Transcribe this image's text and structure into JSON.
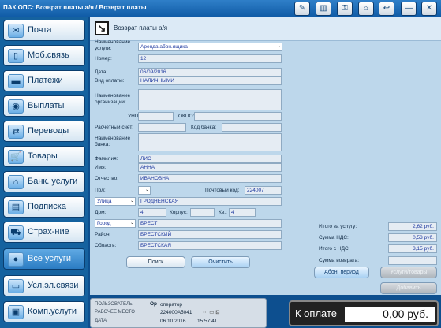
{
  "titlebar": {
    "title": "ПАК ОПС: Возврат платы а/я / Возврат платы",
    "buttons": [
      {
        "name": "wrench-pen-icon",
        "glyph": "✎"
      },
      {
        "name": "barcode-icon",
        "glyph": "▥"
      },
      {
        "name": "key-icon",
        "glyph": "⚿"
      },
      {
        "name": "home-icon",
        "glyph": "⌂"
      },
      {
        "name": "back-arrow-icon",
        "glyph": "↩"
      },
      {
        "name": "minimize-icon",
        "glyph": "—"
      },
      {
        "name": "close-icon",
        "glyph": "✕"
      }
    ]
  },
  "sidebar": {
    "items": [
      {
        "label": "Почта",
        "icon": "envelope-icon",
        "glyph": "✉",
        "active": false
      },
      {
        "label": "Моб.связь",
        "icon": "mobile-phone-icon",
        "glyph": "▯",
        "active": false
      },
      {
        "label": "Платежи",
        "icon": "payment-icon",
        "glyph": "▬",
        "active": false
      },
      {
        "label": "Выплаты",
        "icon": "cash-icon",
        "glyph": "◉",
        "active": false
      },
      {
        "label": "Переводы",
        "icon": "transfer-icon",
        "glyph": "⇄",
        "active": false
      },
      {
        "label": "Товары",
        "icon": "cart-icon",
        "glyph": "🛒",
        "active": false
      },
      {
        "label": "Банк. услуги",
        "icon": "bank-icon",
        "glyph": "⌂",
        "active": false
      },
      {
        "label": "Подписка",
        "icon": "subscription-icon",
        "glyph": "▤",
        "active": false
      },
      {
        "label": "Страх-ние",
        "icon": "car-icon",
        "glyph": "⛟",
        "active": false
      },
      {
        "label": "Все услуги",
        "icon": "all-services-icon",
        "glyph": "●",
        "active": true
      },
      {
        "label": "Усл.эл.связи",
        "icon": "monitor-icon",
        "glyph": "▭",
        "active": false
      },
      {
        "label": "Комп.услуги",
        "icon": "computer-icon",
        "glyph": "▣",
        "active": false
      }
    ]
  },
  "form": {
    "header_title": "Возврат платы а/я",
    "header_icon_glyph": "↘",
    "service_label": "Наименование услуги:",
    "service_value": "Аренда абон.ящика",
    "number_label": "Номер:",
    "number_value": "12",
    "date_label": "Дата:",
    "date_value": "06/09/2016",
    "payment_type_label": "Вид оплаты:",
    "payment_type_value": "НАЛИЧНЫМИ",
    "org_name_label": "Наименование организации:",
    "org_name_value": "",
    "unp_label": "УНП:",
    "unp_value": "",
    "okpo_label": "ОКПО:",
    "okpo_value": "",
    "account_label": "Расчетный счет:",
    "account_value": "",
    "bank_code_label": "Код банка:",
    "bank_code_value": "",
    "bank_name_label": "Наименование банка:",
    "bank_name_value": "",
    "surname_label": "Фамилия:",
    "surname_value": "ЛИС",
    "name_label": "Имя:",
    "name_value": "АННА",
    "patronymic_label": "Отчество:",
    "patronymic_value": "ИВАНОВНА",
    "sex_label": "Пол:",
    "sex_value": "",
    "postcode_label": "Почтовый код:",
    "postcode_value": "224007",
    "street_type_value": "Улица",
    "street_value": "ГРОДНЕНСКАЯ",
    "house_label": "Дом:",
    "house_value": "4",
    "building_label": "Корпус:",
    "building_value": "",
    "apt_label": "Кв.:",
    "apt_value": "4",
    "city_type_value": "Город",
    "city_value": "БРЕСТ",
    "district_label": "Район:",
    "district_value": "БРЕСТСКИЙ",
    "region_label": "Область:",
    "region_value": "БРЕСТСКАЯ",
    "search_button": "Поиск",
    "clear_button": "Очистить"
  },
  "totals": {
    "service_total_label": "Итого за услугу:",
    "service_total_value": "2,62 руб.",
    "vat_label": "Сумма НДС:",
    "vat_value": "0,53 руб.",
    "with_vat_label": "Итого с НДС:",
    "with_vat_value": "3,15 руб.",
    "refund_label": "Сумма возврата:",
    "refund_value": "",
    "abon_period_button": "Абон. период",
    "services_goods_button": "Услуги/товары",
    "add_button": "Добавить"
  },
  "status": {
    "user_label": "ПОЛЬЗОВАТЕЛЬ",
    "user_value": "оператор",
    "user_mark": "Op",
    "workplace_label": "РАБОЧЕЕ МЕСТО",
    "workplace_value": "224000A5041",
    "date_label": "ДАТА",
    "date_value": "06.10.2016",
    "time_value": "15:57:41"
  },
  "payment": {
    "label": "К оплате",
    "value": "0,00 руб."
  },
  "colors": {
    "accent": "#15629f",
    "form_bg": "#bdd7eb",
    "value_text": "#1f3aa0"
  }
}
